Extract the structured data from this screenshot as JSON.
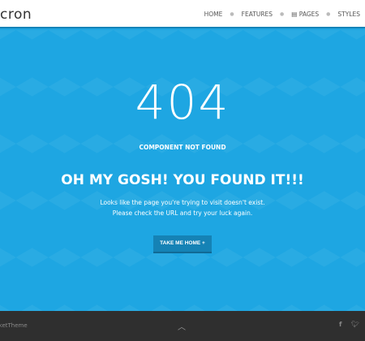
{
  "header": {
    "logo": "cron",
    "nav": [
      {
        "label": "HOME"
      },
      {
        "label": "FEATURES"
      },
      {
        "label": "PAGES",
        "icon": "document-icon"
      },
      {
        "label": "STYLES"
      }
    ]
  },
  "main": {
    "code": "404",
    "subtitle": "COMPONENT NOT FOUND",
    "heading": "OH MY GOSH! YOU FOUND IT!!!",
    "line1": "Looks like the page you're trying to visit doesn't exist.",
    "line2": "Please check the URL and try your luck again.",
    "button": "TAKE ME HOME +"
  },
  "footer": {
    "copyright": "RocketTheme",
    "icons": [
      "chevron-up-icon",
      "facebook-icon",
      "twitter-icon"
    ]
  },
  "colors": {
    "accent": "#1ea6e2",
    "button": "#1582b5",
    "footer": "#2f2f2f"
  }
}
